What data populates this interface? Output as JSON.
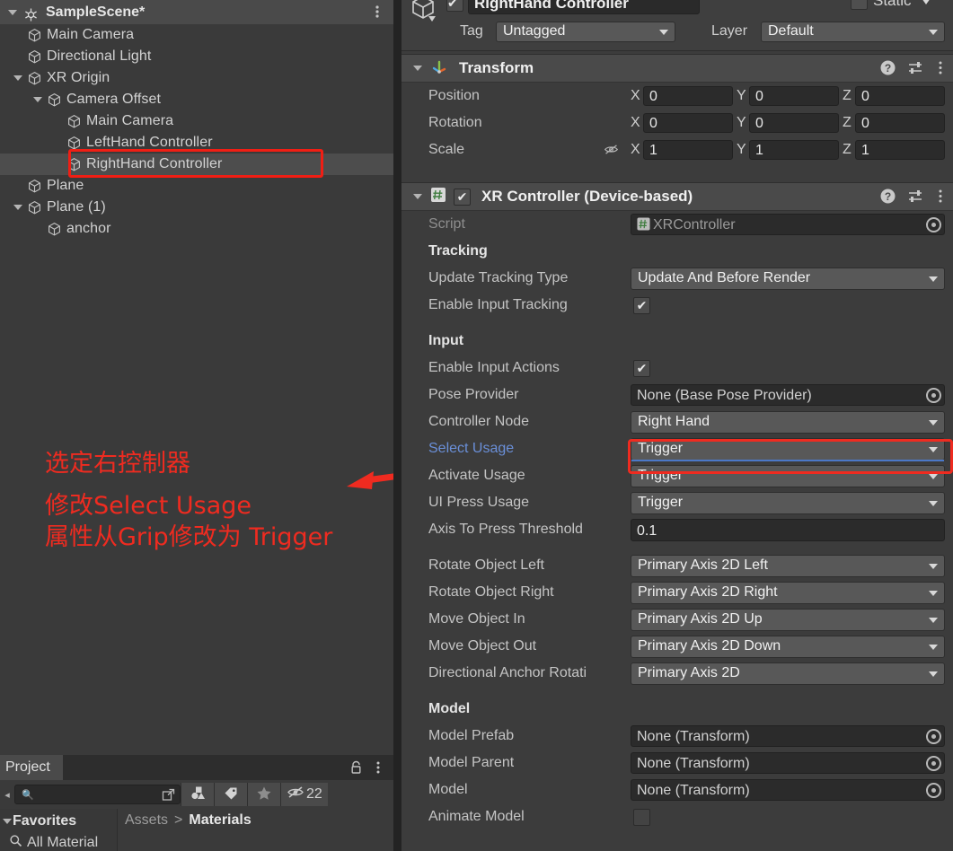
{
  "hierarchy": {
    "title": "SampleScene*",
    "menu_icon": "kebab-menu-icon",
    "items": [
      {
        "label": "Main Camera",
        "depth": 1,
        "expandable": false,
        "selected": false
      },
      {
        "label": "Directional Light",
        "depth": 1,
        "expandable": false,
        "selected": false
      },
      {
        "label": "XR Origin",
        "depth": 1,
        "expandable": true,
        "selected": false
      },
      {
        "label": "Camera Offset",
        "depth": 2,
        "expandable": true,
        "selected": false
      },
      {
        "label": "Main Camera",
        "depth": 3,
        "expandable": false,
        "selected": false
      },
      {
        "label": "LeftHand Controller",
        "depth": 3,
        "expandable": false,
        "selected": false
      },
      {
        "label": "RightHand Controller",
        "depth": 3,
        "expandable": false,
        "selected": true
      },
      {
        "label": "Plane",
        "depth": 1,
        "expandable": false,
        "selected": false
      },
      {
        "label": "Plane (1)",
        "depth": 1,
        "expandable": true,
        "selected": false
      },
      {
        "label": "anchor",
        "depth": 2,
        "expandable": false,
        "selected": false
      }
    ]
  },
  "annotation": {
    "color": "#ef2b20",
    "line1": "选定右控制器",
    "line2": "修改Select Usage",
    "line3": "属性从Grip修改为 Trigger",
    "arrow": "red-arrow-pointing-left"
  },
  "project": {
    "tab_label": "Project",
    "lock_icon": "lock-icon",
    "menu_icon": "kebab-menu-icon",
    "search_value": "",
    "search_placeholder": "",
    "search_icon": "magnifier-icon",
    "expand_icon": "open-in-new-icon",
    "filter_by_type_icon": "filter-by-type-icon",
    "filter_by_label_icon": "label-tag-icon",
    "favorites_icon": "star-icon",
    "hidden_count_icon": "eye-off-icon",
    "hidden_count": "22",
    "favorites_label": "Favorites",
    "favorites_children": [
      "All Material"
    ],
    "breadcrumb": [
      "Assets",
      "Materials"
    ],
    "breadcrumb_separator": ">"
  },
  "inspector": {
    "gameobject": {
      "icon": "gameobject-cube-icon",
      "enabled_checkbox": true,
      "name": "RightHand Controller",
      "static_label": "Static",
      "static_checked": false,
      "tag_label": "Tag",
      "tag_value": "Untagged",
      "layer_label": "Layer",
      "layer_value": "Default"
    },
    "transform": {
      "title": "Transform",
      "icon": "transform-axis-icon",
      "help_icon": "help-icon",
      "preset_icon": "preset-sliders-icon",
      "menu_icon": "kebab-menu-icon",
      "rows": [
        {
          "label": "Position",
          "x": "0",
          "y": "0",
          "z": "0",
          "hidden_icon": false
        },
        {
          "label": "Rotation",
          "x": "0",
          "y": "0",
          "z": "0",
          "hidden_icon": false
        },
        {
          "label": "Scale",
          "x": "1",
          "y": "1",
          "z": "1",
          "hidden_icon": true
        }
      ],
      "axis_labels": [
        "X",
        "Y",
        "Z"
      ],
      "constrain_icon": "eye-off-icon"
    },
    "xr_controller": {
      "title": "XR Controller (Device-based)",
      "icon": "script-hash-icon",
      "enabled": true,
      "help_icon": "help-icon",
      "preset_icon": "preset-sliders-icon",
      "menu_icon": "kebab-menu-icon",
      "script_label": "Script",
      "script_value": "XRController",
      "sections": {
        "tracking": "Tracking",
        "input": "Input",
        "model": "Model"
      },
      "fields": [
        {
          "label": "Update Tracking Type",
          "type": "dropdown",
          "value": "Update And Before Render"
        },
        {
          "label": "Enable Input Tracking",
          "type": "checkbox",
          "value": true
        },
        {
          "label": "Enable Input Actions",
          "type": "checkbox",
          "value": true
        },
        {
          "label": "Pose Provider",
          "type": "object",
          "value": "None (Base Pose Provider)"
        },
        {
          "label": "Controller Node",
          "type": "dropdown",
          "value": "Right Hand"
        },
        {
          "label": "Select Usage",
          "type": "dropdown",
          "value": "Trigger",
          "highlighted": true,
          "focused": true
        },
        {
          "label": "Activate Usage",
          "type": "dropdown",
          "value": "Trigger"
        },
        {
          "label": "UI Press Usage",
          "type": "dropdown",
          "value": "Trigger"
        },
        {
          "label": "Axis To Press Threshold",
          "type": "number",
          "value": "0.1"
        },
        {
          "label": "Rotate Object Left",
          "type": "dropdown",
          "value": "Primary Axis 2D Left"
        },
        {
          "label": "Rotate Object Right",
          "type": "dropdown",
          "value": "Primary Axis 2D Right"
        },
        {
          "label": "Move Object In",
          "type": "dropdown",
          "value": "Primary Axis 2D Up"
        },
        {
          "label": "Move Object Out",
          "type": "dropdown",
          "value": "Primary Axis 2D Down"
        },
        {
          "label": "Directional Anchor Rotati",
          "type": "dropdown",
          "value": "Primary Axis 2D"
        },
        {
          "label": "Model Prefab",
          "type": "object",
          "value": "None (Transform)"
        },
        {
          "label": "Model Parent",
          "type": "object",
          "value": "None (Transform)"
        },
        {
          "label": "Model",
          "type": "object",
          "value": "None (Transform)"
        },
        {
          "label": "Animate Model",
          "type": "checkbox",
          "value": false
        }
      ]
    }
  }
}
